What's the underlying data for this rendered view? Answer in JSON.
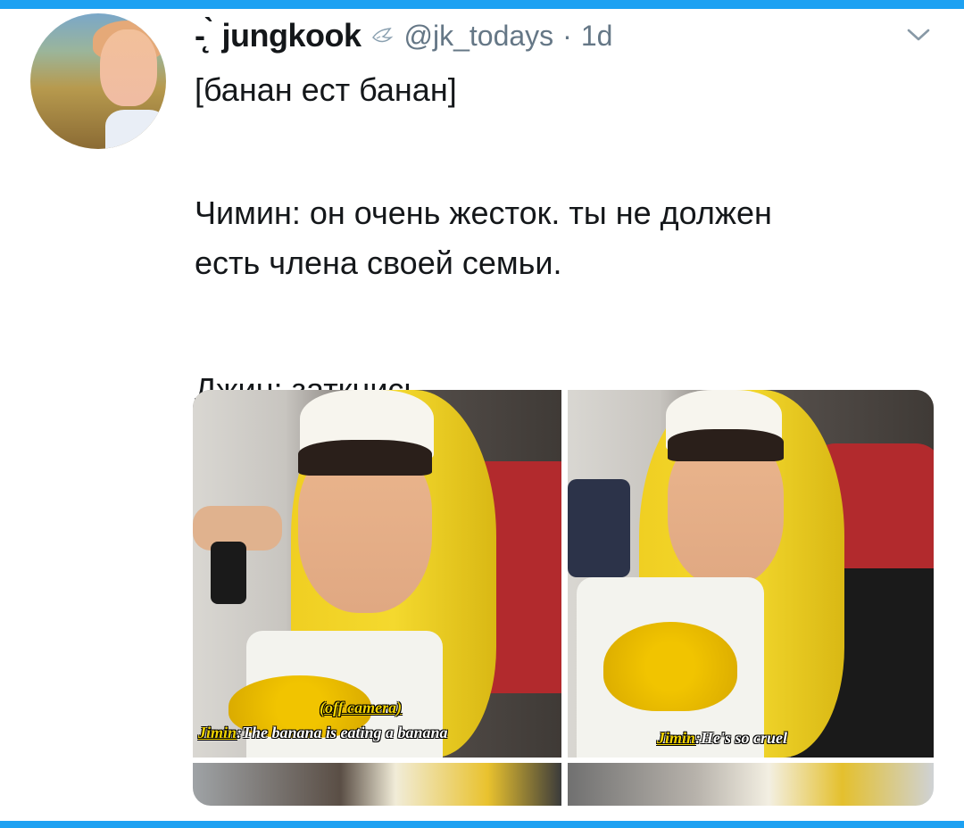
{
  "tweet": {
    "display_name": "-̨ ̀ jungkook",
    "handle": "@jk_todays",
    "separator": "·",
    "time": "1d",
    "text": {
      "line1": "[банан ест банан]",
      "line2": "Чимин: он очень жесток. ты не должен",
      "line3": "есть члена своей семьи.",
      "line4": "Джин: заткнись."
    },
    "icons": {
      "verified": "dove-icon",
      "menu": "chevron-down-icon"
    }
  },
  "media": {
    "left_panel": {
      "off_camera_caption": "(off camera)",
      "speaker": "Jimin",
      "line": "The banana is eating a banana"
    },
    "right_panel": {
      "speaker": "Jimin",
      "line": "He's so cruel"
    }
  },
  "colors": {
    "accent": "#1da1f2",
    "secondary_text": "#657786",
    "caption_yellow": "#f2d400"
  }
}
